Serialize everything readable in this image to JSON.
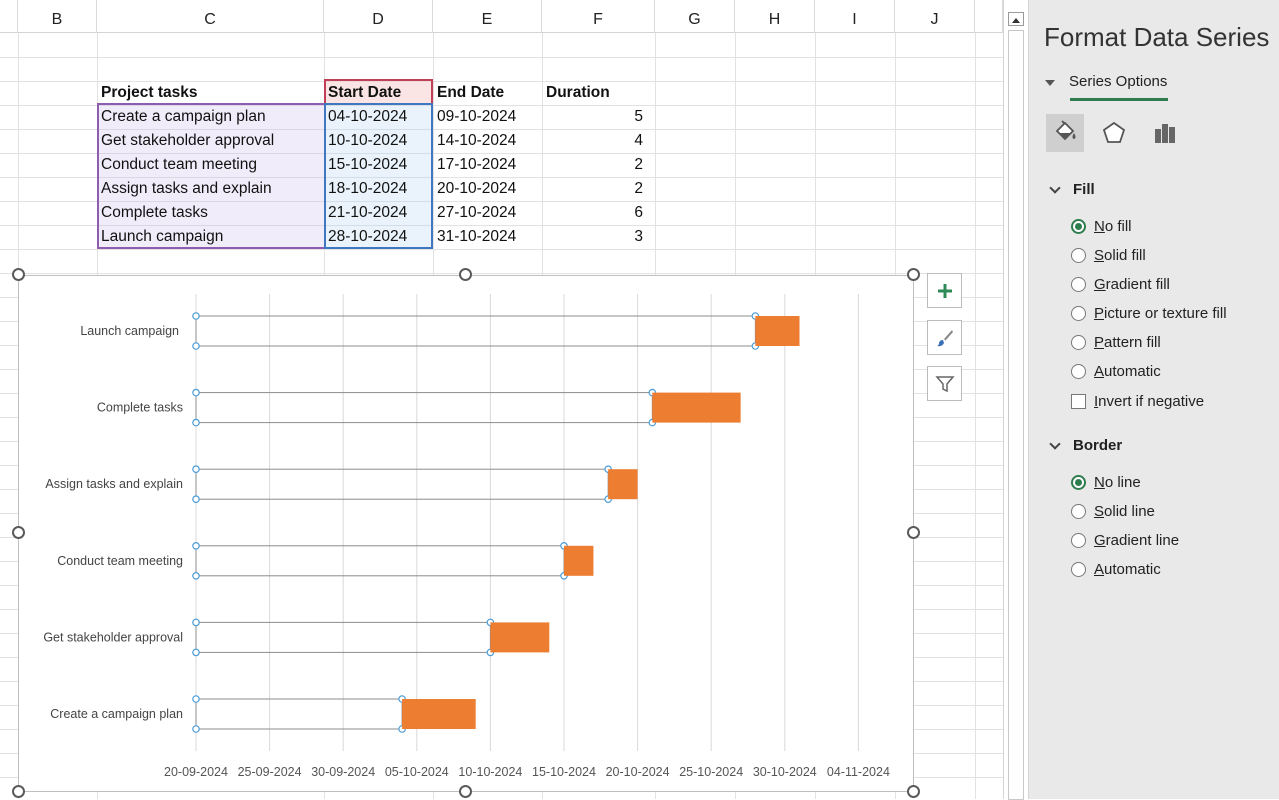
{
  "columns": [
    "B",
    "C",
    "D",
    "E",
    "F",
    "G",
    "H",
    "I",
    "J"
  ],
  "table": {
    "headers": [
      "Project tasks",
      "Start Date",
      "End Date",
      "Duration"
    ],
    "rows": [
      [
        "Create a campaign plan",
        "04-10-2024",
        "09-10-2024",
        "5"
      ],
      [
        "Get stakeholder approval",
        "10-10-2024",
        "14-10-2024",
        "4"
      ],
      [
        "Conduct team meeting",
        "15-10-2024",
        "17-10-2024",
        "2"
      ],
      [
        "Assign tasks and explain",
        "18-10-2024",
        "20-10-2024",
        "2"
      ],
      [
        "Complete tasks",
        "21-10-2024",
        "27-10-2024",
        "6"
      ],
      [
        "Launch campaign",
        "28-10-2024",
        "31-10-2024",
        "3"
      ]
    ]
  },
  "chart_data": {
    "type": "bar",
    "orientation": "horizontal",
    "stacked": true,
    "categories": [
      "Launch campaign",
      "Complete tasks",
      "Assign tasks and explain",
      "Conduct team meeting",
      "Get stakeholder approval",
      "Create a campaign plan"
    ],
    "series": [
      {
        "values": [
          "28-10-2024",
          "21-10-2024",
          "18-10-2024",
          "15-10-2024",
          "10-10-2024",
          "04-10-2024"
        ],
        "fill": "none"
      },
      {
        "values": [
          3,
          6,
          2,
          2,
          4,
          5
        ],
        "fill": "#ed7d31"
      }
    ],
    "x_ticks": [
      "20-09-2024",
      "25-09-2024",
      "30-09-2024",
      "05-10-2024",
      "10-10-2024",
      "15-10-2024",
      "20-10-2024",
      "25-10-2024",
      "30-10-2024",
      "04-11-2024"
    ],
    "xlim": [
      "20-09-2024",
      "08-11-2024"
    ],
    "grid": "vertical",
    "bar_color": "#ed7d31"
  },
  "chart_tools": {
    "plus_icon": "chart-elements-icon",
    "brush_icon": "chart-styles-icon",
    "filter_icon": "chart-filters-icon"
  },
  "pane": {
    "title": "Format Data Series",
    "section": "Series Options",
    "fill_heading": "Fill",
    "fill_options": [
      {
        "label": "No fill",
        "key": "N",
        "rest": "o fill",
        "selected": true
      },
      {
        "label": "Solid fill",
        "key": "S",
        "rest": "olid fill",
        "selected": false
      },
      {
        "label": "Gradient fill",
        "key": "G",
        "rest": "radient fill",
        "selected": false
      },
      {
        "label": "Picture or texture fill",
        "key": "P",
        "rest": "icture or texture fill",
        "selected": false
      },
      {
        "label": "Pattern fill",
        "key": "P",
        "rest": "attern fill",
        "selected": false
      },
      {
        "label": "Automatic",
        "key": "A",
        "rest": "utomatic",
        "selected": false
      }
    ],
    "invert_label": "Invert if negative",
    "invert_key": "I",
    "invert_rest": "nvert if negative",
    "border_heading": "Border",
    "border_options": [
      {
        "label": "No line",
        "key": "N",
        "rest": "o line",
        "selected": true
      },
      {
        "label": "Solid line",
        "key": "S",
        "rest": "olid line",
        "selected": false
      },
      {
        "label": "Gradient line",
        "key": "G",
        "rest": "radient line",
        "selected": false
      },
      {
        "label": "Automatic",
        "key": "A",
        "rest": "utomatic",
        "selected": false
      }
    ],
    "accent_color": "#2e7d4f"
  }
}
